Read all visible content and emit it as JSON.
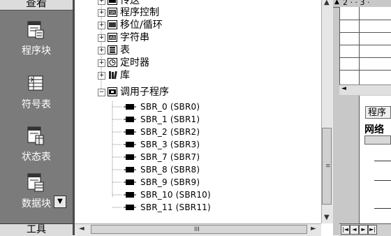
{
  "sidebar": {
    "header": "查看",
    "items": [
      {
        "label": "程序块",
        "icon": "program-block-icon"
      },
      {
        "label": "符号表",
        "icon": "symbol-table-icon"
      },
      {
        "label": "状态表",
        "icon": "status-table-icon"
      },
      {
        "label": "数据块",
        "icon": "data-block-icon"
      }
    ],
    "footer": "工具"
  },
  "tree": {
    "folders": [
      {
        "label": "传送",
        "icon": "transfer-icon"
      },
      {
        "label": "程序控制",
        "icon": "program-control-icon"
      },
      {
        "label": "移位/循环",
        "icon": "shift-rotate-icon"
      },
      {
        "label": "字符串",
        "icon": "string-icon"
      },
      {
        "label": "表",
        "icon": "table-icon"
      },
      {
        "label": "定时器",
        "icon": "timer-icon"
      },
      {
        "label": "库",
        "icon": "library-icon"
      },
      {
        "label": "调用子程序",
        "icon": "call-subroutine-icon",
        "expanded": true
      }
    ],
    "subroutines": [
      "SBR_0 (SBR0)",
      "SBR_1 (SBR1)",
      "SBR_2 (SBR2)",
      "SBR_3 (SBR3)",
      "SBR_7 (SBR7)",
      "SBR_8 (SBR8)",
      "SBR_9 (SBR9)",
      "SBR_10 (SBR10)",
      "SBR_11 (SBR11)"
    ]
  },
  "editor": {
    "tabs_text": "2 · · 3 ·",
    "program_tab": "程序",
    "network_label": "网络"
  },
  "scroll": {
    "h_grip": "III",
    "v_grip": "≡"
  }
}
